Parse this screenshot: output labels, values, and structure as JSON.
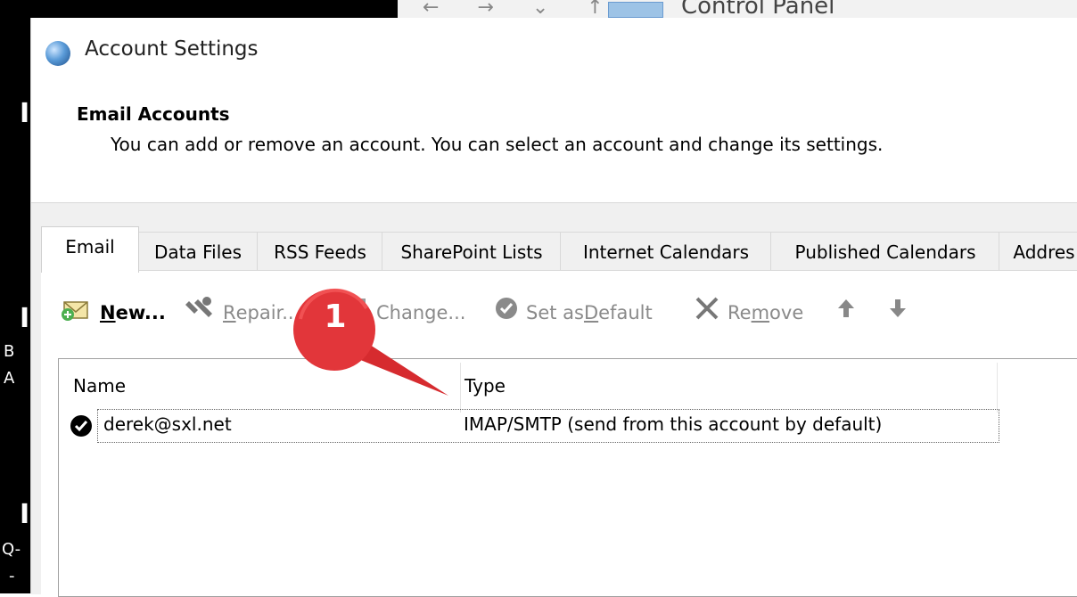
{
  "background": {
    "address_bar": "Control Panel",
    "left_fragments": [
      "B",
      "A",
      "Q-",
      "-"
    ]
  },
  "dialog": {
    "title": "Account Settings",
    "header_title": "Email Accounts",
    "header_desc": "You can add or remove an account. You can select an account and change its settings."
  },
  "tabs": [
    {
      "label": "Email",
      "active": true
    },
    {
      "label": "Data Files"
    },
    {
      "label": "RSS Feeds"
    },
    {
      "label": "SharePoint Lists"
    },
    {
      "label": "Internet Calendars"
    },
    {
      "label": "Published Calendars"
    },
    {
      "label": "Addres"
    }
  ],
  "toolbar": {
    "new": {
      "pre": "",
      "u": "N",
      "post": "ew...",
      "icon": "new-mail-icon",
      "enabled": true
    },
    "repair": {
      "pre": "",
      "u": "R",
      "post": "epair...",
      "icon": "wrench-icon",
      "enabled": false
    },
    "change": {
      "pre": "",
      "u": "",
      "post": "Change...",
      "icon": "change-icon",
      "enabled": false
    },
    "set_default": {
      "pre": "Set as ",
      "u": "D",
      "post": "efault",
      "icon": "checkmark-circle-icon",
      "enabled": false
    },
    "remove": {
      "pre": "Re",
      "u": "m",
      "post": "ove",
      "icon": "x-icon",
      "enabled": false
    },
    "move_up": {
      "icon": "arrow-up-icon"
    },
    "move_down": {
      "icon": "arrow-down-icon"
    }
  },
  "list": {
    "columns": [
      "Name",
      "Type"
    ],
    "rows": [
      {
        "name": "derek@sxl.net",
        "type": "IMAP/SMTP (send from this account by default)",
        "default": true
      }
    ]
  },
  "callout": {
    "number": "1",
    "color": "#e2363a"
  }
}
